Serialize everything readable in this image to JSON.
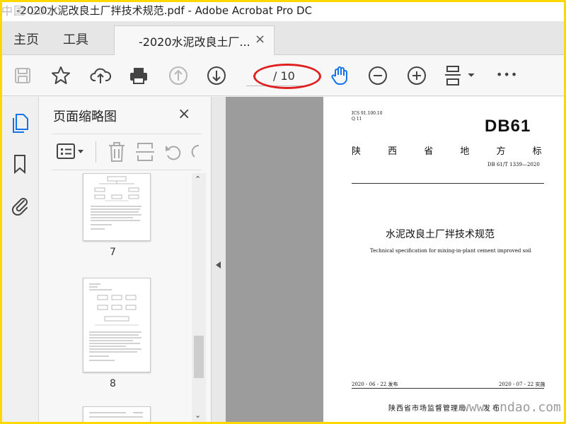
{
  "window": {
    "title": "-2020水泥改良土厂拌技术规范.pdf - Adobe Acrobat Pro DC",
    "watermark_top": "中国-2020",
    "watermark_bottom": "www.cndao.com"
  },
  "menu": {
    "home": "主页",
    "tools": "工具",
    "doc_tab_label": "-2020水泥改良土厂...",
    "doc_tab_close": "×"
  },
  "toolbar": {
    "page_total": "/ 10",
    "more": "•••"
  },
  "thumbnail_panel": {
    "title": "页面缩略图",
    "close": "×",
    "pages": [
      {
        "number": "7"
      },
      {
        "number": "8"
      }
    ]
  },
  "document": {
    "ics": "ICS 91.100.10",
    "ccs": "Q 11",
    "code": "DB61",
    "province_standard": "陕 西 省 地 方 标 准",
    "standard_number": "DB 61/T 1339—2020",
    "title_cn": "水泥改良土厂拌技术规范",
    "title_en": "Technical specification for mixing-in-plant cement improved soil",
    "issue_date": "2020 - 06 - 22 发布",
    "effective_date": "2020 - 07 - 22 实施",
    "issuer": "陕西省市场监督管理局",
    "issuer_action": "发 布"
  },
  "colors": {
    "accent_blue": "#1473e6",
    "annotation_red": "#e02020",
    "frame_yellow": "#ffd800"
  }
}
